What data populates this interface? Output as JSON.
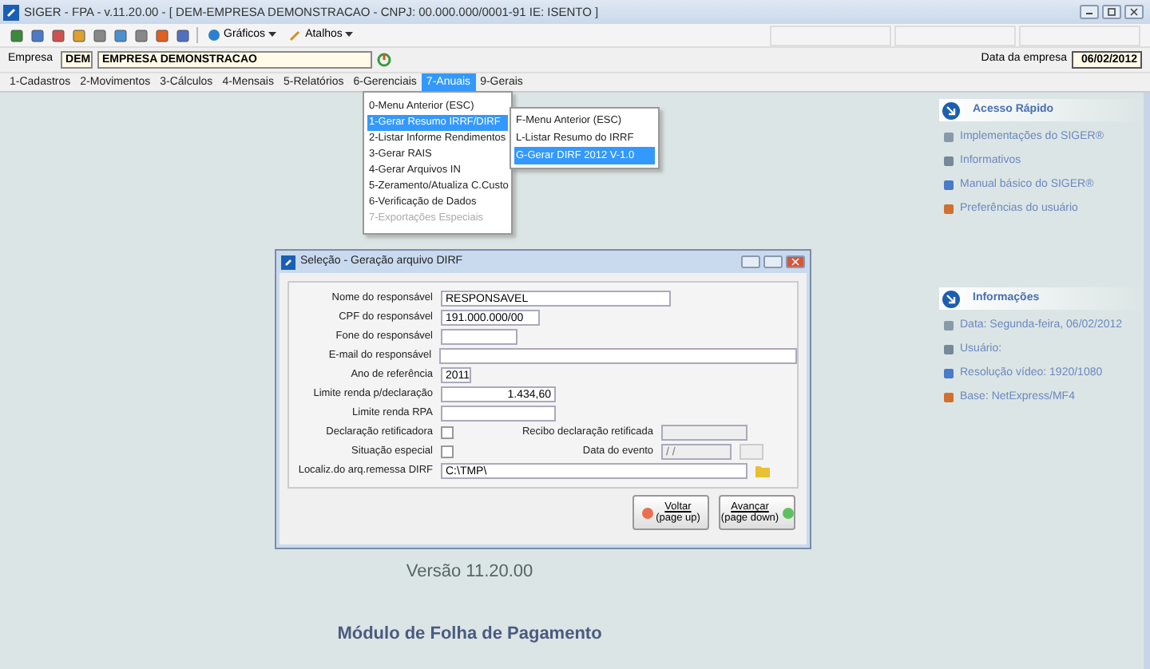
{
  "window": {
    "title": "SIGER - FPA - v.11.20.00 - [ DEM-EMPRESA DEMONSTRACAO - CNPJ: 00.000.000/0001-91 IE: ISENTO ]"
  },
  "toolbar": {
    "buttons": [
      {
        "label": "Gráficos"
      },
      {
        "label": "Atalhos"
      }
    ]
  },
  "company": {
    "label": "Empresa",
    "code": "DEM",
    "name": "EMPRESA DEMONSTRACAO",
    "date_label": "Data da empresa",
    "date": "06/02/2012"
  },
  "menu": [
    {
      "label": "1-Cadastros",
      "selected": false
    },
    {
      "label": "2-Movimentos",
      "selected": false
    },
    {
      "label": "3-Cálculos",
      "selected": false
    },
    {
      "label": "4-Mensais",
      "selected": false
    },
    {
      "label": "5-Relatórios",
      "selected": false
    },
    {
      "label": "6-Gerenciais",
      "selected": false
    },
    {
      "label": "7-Anuais",
      "selected": true
    },
    {
      "label": "9-Gerais",
      "selected": false
    }
  ],
  "dropdown": [
    {
      "label": "0-Menu Anterior (ESC)",
      "selected": false,
      "disabled": false
    },
    {
      "label": "1-Gerar Resumo IRRF/DIRF",
      "selected": true,
      "disabled": false
    },
    {
      "label": "2-Listar Informe Rendimentos",
      "selected": false,
      "disabled": false
    },
    {
      "label": "3-Gerar RAIS",
      "selected": false,
      "disabled": false
    },
    {
      "label": "4-Gerar Arquivos IN",
      "selected": false,
      "disabled": false
    },
    {
      "label": "5-Zeramento/Atualiza C.Custo",
      "selected": false,
      "disabled": false
    },
    {
      "label": "6-Verificação de Dados",
      "selected": false,
      "disabled": false
    },
    {
      "label": "7-Exportações Especiais",
      "selected": false,
      "disabled": true
    }
  ],
  "submenu": [
    {
      "label": "F-Menu Anterior (ESC)",
      "selected": false
    },
    {
      "label": "L-Listar Resumo do IRRF",
      "selected": false
    },
    {
      "label": "G-Gerar DIRF 2012 V-1.0",
      "selected": true
    }
  ],
  "quick_access": {
    "title": "Acesso Rápido",
    "items": [
      "Implementações do SIGER®",
      "Informativos",
      "Manual básico do SIGER®",
      "Preferências do usuário"
    ]
  },
  "info": {
    "title": "Informações",
    "items": [
      "Data: Segunda-feira, 06/02/2012",
      "Usuário:",
      "Resolução vídeo: 1920/1080",
      "Base: NetExpress/MF4"
    ]
  },
  "version": "Versão 11.20.00",
  "module": "Módulo de Folha de Pagamento",
  "dialog": {
    "title": "Seleção - Geração arquivo DIRF",
    "rows": [
      {
        "kind": "text",
        "label": "Nome do responsável",
        "value": "RESPONSAVEL"
      },
      {
        "kind": "text",
        "label": "CPF do responsável",
        "value": "191.000.000/00"
      },
      {
        "kind": "text",
        "label": "Fone do responsável"
      },
      {
        "kind": "text",
        "label": "E-mail do responsável"
      },
      {
        "kind": "text",
        "label": "Ano de referência",
        "value": "2011"
      },
      {
        "kind": "number",
        "label": "Limite renda p/declaração",
        "value": "1.434,60"
      },
      {
        "kind": "text",
        "label": "Limite renda RPA"
      },
      {
        "kind": "check",
        "label": "Declaração retificadora",
        "checked": false,
        "extra": {
          "label": "Recibo declaração retificada",
          "disabled": true
        }
      },
      {
        "kind": "check",
        "label": "Situação especial",
        "checked": false,
        "extra": {
          "label": "Data do evento",
          "value": "/ /",
          "disabled": true
        }
      },
      {
        "kind": "path",
        "label": "Localiz.do arq.remessa DIRF",
        "value": "C:\\TMP\\"
      }
    ],
    "buttons": [
      {
        "kind": "back",
        "label": "Voltar",
        "hint": "(page up)"
      },
      {
        "kind": "next",
        "label": "Avançar",
        "hint": "(page down)"
      }
    ]
  }
}
